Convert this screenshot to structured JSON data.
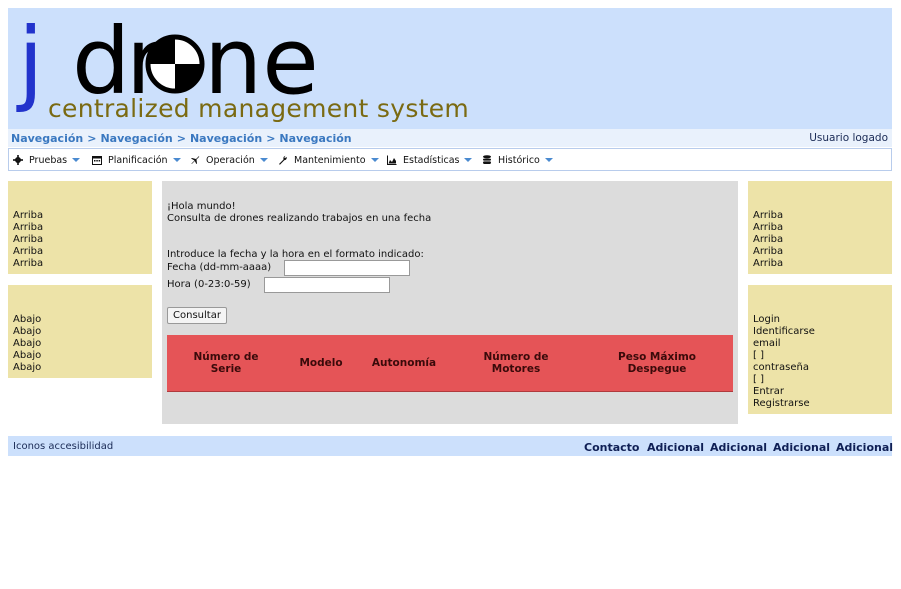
{
  "header": {
    "logo_j": "j",
    "logo_d": "d",
    "logo_r": "r",
    "logo_rest": "ne",
    "tagline": "centralized management system"
  },
  "breadcrumb": {
    "items": [
      "Navegación",
      "Navegación",
      "Navegación",
      "Navegación"
    ],
    "separator": ">",
    "user": "Usuario logado"
  },
  "menu": {
    "items": [
      {
        "label": "Pruebas",
        "icon": "gear-icon"
      },
      {
        "label": "Planificación",
        "icon": "calendar-icon"
      },
      {
        "label": "Operación",
        "icon": "plane-icon"
      },
      {
        "label": "Mantenimiento",
        "icon": "wrench-icon"
      },
      {
        "label": "Estadísticas",
        "icon": "chart-icon"
      },
      {
        "label": "Histórico",
        "icon": "database-icon"
      }
    ]
  },
  "left_top": {
    "items": [
      "Arriba",
      "Arriba",
      "Arriba",
      "Arriba",
      "Arriba"
    ]
  },
  "left_bottom": {
    "items": [
      "Abajo",
      "Abajo",
      "Abajo",
      "Abajo",
      "Abajo"
    ]
  },
  "right_top": {
    "items": [
      "Arriba",
      "Arriba",
      "Arriba",
      "Arriba",
      "Arriba"
    ]
  },
  "login": {
    "title": "Login",
    "identify": "Identificarse",
    "email_label": "email",
    "email_box": "[ ]",
    "password_label": "contraseña",
    "password_box": "[ ]",
    "enter": "Entrar",
    "register": "Registrarse"
  },
  "main": {
    "greeting": "¡Hola mundo!",
    "subtitle": "Consulta de drones realizando trabajos en una fecha",
    "instructions": "Introduce la fecha y la hora en el formato indicado:",
    "date_label": "Fecha (dd-mm-aaaa)",
    "date_value": "",
    "hour_label": "Hora (0-23:0-59)",
    "hour_value": "",
    "submit_label": "Consultar",
    "table_headers": [
      "Número de Serie",
      "Modelo",
      "Autonomía",
      "Número de Motores",
      "Peso Máximo Despegue"
    ]
  },
  "footer": {
    "accessibility": "Iconos accesibilidad",
    "links": [
      "Contacto",
      "Adicional",
      "Adicional",
      "Adicional",
      "Adicional"
    ]
  },
  "colors": {
    "header_bg": "#cce0fc",
    "side_box": "#ede3a8",
    "table_header": "#e55457",
    "logo_j": "#2233cc",
    "tagline": "#7a6a12"
  }
}
